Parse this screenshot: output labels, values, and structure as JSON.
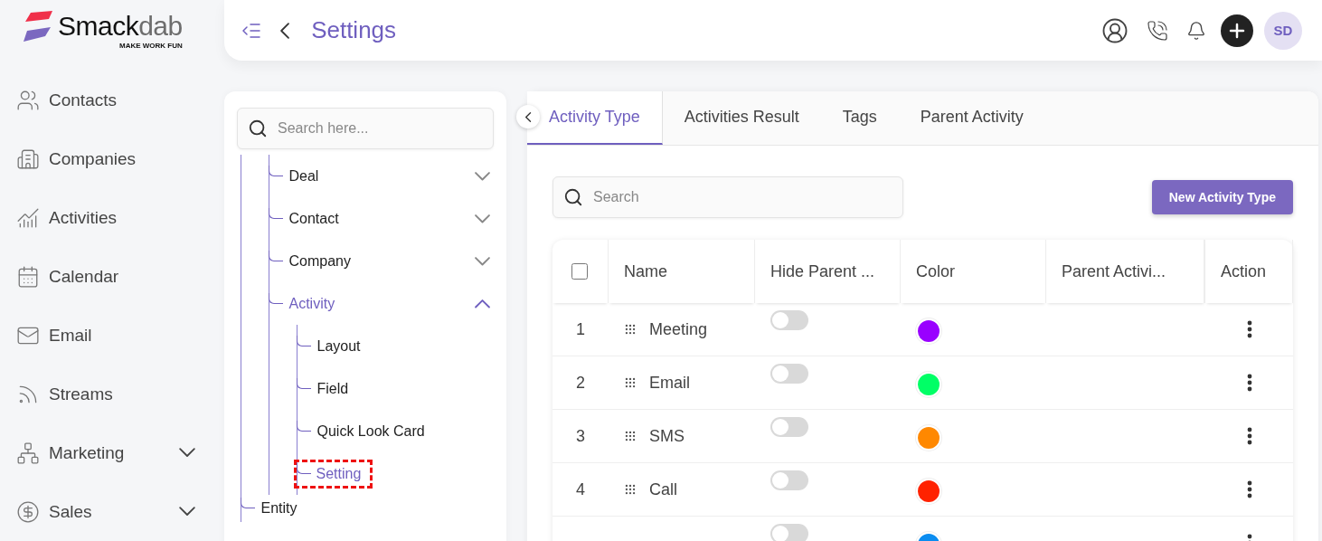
{
  "logo": {
    "name_dark": "Smack",
    "name_light": "dab",
    "tagline": "MAKE WORK FUN"
  },
  "nav": [
    {
      "label": "Contacts",
      "kind": "link"
    },
    {
      "label": "Companies",
      "kind": "link"
    },
    {
      "label": "Activities",
      "kind": "link"
    },
    {
      "label": "Calendar",
      "kind": "link"
    },
    {
      "label": "Email",
      "kind": "link"
    },
    {
      "label": "Streams",
      "kind": "link"
    },
    {
      "label": "Marketing",
      "kind": "group",
      "expanded": false
    },
    {
      "label": "Sales",
      "kind": "group",
      "expanded": false
    }
  ],
  "header": {
    "title": "Settings",
    "avatar": "SD"
  },
  "tree": {
    "search": {
      "placeholder": "Search here..."
    },
    "items": [
      {
        "label": "Deal",
        "selected": false,
        "expanded": false
      },
      {
        "label": "Contact",
        "selected": false,
        "expanded": false
      },
      {
        "label": "Company",
        "selected": false,
        "expanded": false
      },
      {
        "label": "Activity",
        "selected": true,
        "expanded": true,
        "children": [
          {
            "label": "Layout",
            "selected": false,
            "highlighted": false
          },
          {
            "label": "Field",
            "selected": false,
            "highlighted": false
          },
          {
            "label": "Quick Look Card",
            "selected": false,
            "highlighted": false
          },
          {
            "label": "Setting",
            "selected": true,
            "highlighted": true
          }
        ]
      }
    ],
    "outer_items": [
      {
        "label": "Entity",
        "selected": false
      }
    ]
  },
  "tabs": [
    {
      "label": "Activity Type",
      "selected": true
    },
    {
      "label": "Activities Result",
      "selected": false
    },
    {
      "label": "Tags",
      "selected": false
    },
    {
      "label": "Parent Activity",
      "selected": false
    }
  ],
  "search": {
    "placeholder": "Search"
  },
  "new_button": "New Activity Type",
  "table": {
    "select_all": {
      "checked": false
    },
    "columns": [
      "Name",
      "Hide Parent ...",
      "Color",
      "Parent Activi...",
      "Action"
    ],
    "rows": [
      {
        "number": "1",
        "name": "Meeting",
        "hide_parent": false,
        "color": "#9900ff"
      },
      {
        "number": "2",
        "name": "Email",
        "hide_parent": false,
        "color": "#00ff66"
      },
      {
        "number": "3",
        "name": "SMS",
        "hide_parent": false,
        "color": "#ff8800"
      },
      {
        "number": "4",
        "name": "Call",
        "hide_parent": false,
        "color": "#ff2200"
      },
      {
        "hide_parent": false,
        "color": "#0a8cf0"
      }
    ]
  }
}
